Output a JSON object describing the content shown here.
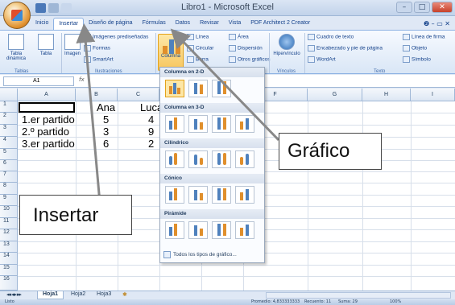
{
  "window": {
    "title": "Libro1 - Microsoft Excel",
    "min_label": "–",
    "max_label": "□",
    "close_label": "✕"
  },
  "tabs": [
    "Inicio",
    "Insertar",
    "Diseño de página",
    "Fórmulas",
    "Datos",
    "Revisar",
    "Vista",
    "PDF Architect 2 Creator"
  ],
  "help_icons": "❷ – ▭ ✕",
  "ribbon": {
    "tabla_dinamica": "Tabla dinámica",
    "tabla": "Tabla",
    "tablas_group": "Tablas",
    "imagen": "Imagen",
    "imagenes_prediseñadas": "Imágenes prediseñadas",
    "formas": "Formas",
    "smartart": "SmartArt",
    "ilustraciones_group": "Ilustraciones",
    "columna": "Columna",
    "linea": "Línea",
    "area": "Área",
    "circular": "Circular",
    "dispersion": "Dispersión",
    "barra": "Barra",
    "otros_graficos": "Otros gráficos",
    "hipervinculo": "Hipervínculo",
    "vinculos_group": "Vínculos",
    "cuadro_texto": "Cuadro de texto",
    "encabezado": "Encabezado y pie de página",
    "wordart": "WordArt",
    "linea_firma": "Línea de firma",
    "objeto": "Objeto",
    "simbolo": "Símbolo",
    "texto_group": "Texto"
  },
  "formula_bar": {
    "name_box": "A1",
    "fx": "fx"
  },
  "columns": [
    "A",
    "B",
    "C",
    "D",
    "E",
    "F",
    "G",
    "H",
    "I"
  ],
  "rows": [
    "1",
    "2",
    "3",
    "4",
    "5",
    "6",
    "7",
    "8",
    "9",
    "10",
    "11",
    "12",
    "13",
    "14",
    "15",
    "16"
  ],
  "cells": {
    "b1": "Ana",
    "c1": "Luca",
    "a2": "1.er partido",
    "b2": "5",
    "c2": "4",
    "a3": "2.º partido",
    "b3": "3",
    "c3": "9",
    "a4": "3.er partido",
    "b4": "6",
    "c4": "2"
  },
  "dropdown": {
    "sections": [
      "Columna en 2-D",
      "Columna en 3-D",
      "Cilíndrico",
      "Cónico",
      "Pirámide"
    ],
    "footer": "Todos los tipos de gráfico..."
  },
  "sheets": [
    "Hoja1",
    "Hoja2",
    "Hoja3"
  ],
  "status": {
    "left": "Listo",
    "promedio": "Promedio: 4,833333333",
    "recuento": "Recuento: 11",
    "suma": "Suma: 29",
    "zoom": "100%"
  },
  "callouts": {
    "grafico": "Gráfico",
    "insertar": "Insertar"
  },
  "colors": {
    "ribbon_accent": "#15428b",
    "highlight": "#fde7a6",
    "bar_blue": "#4f81bd",
    "bar_orange": "#e08f2c"
  }
}
